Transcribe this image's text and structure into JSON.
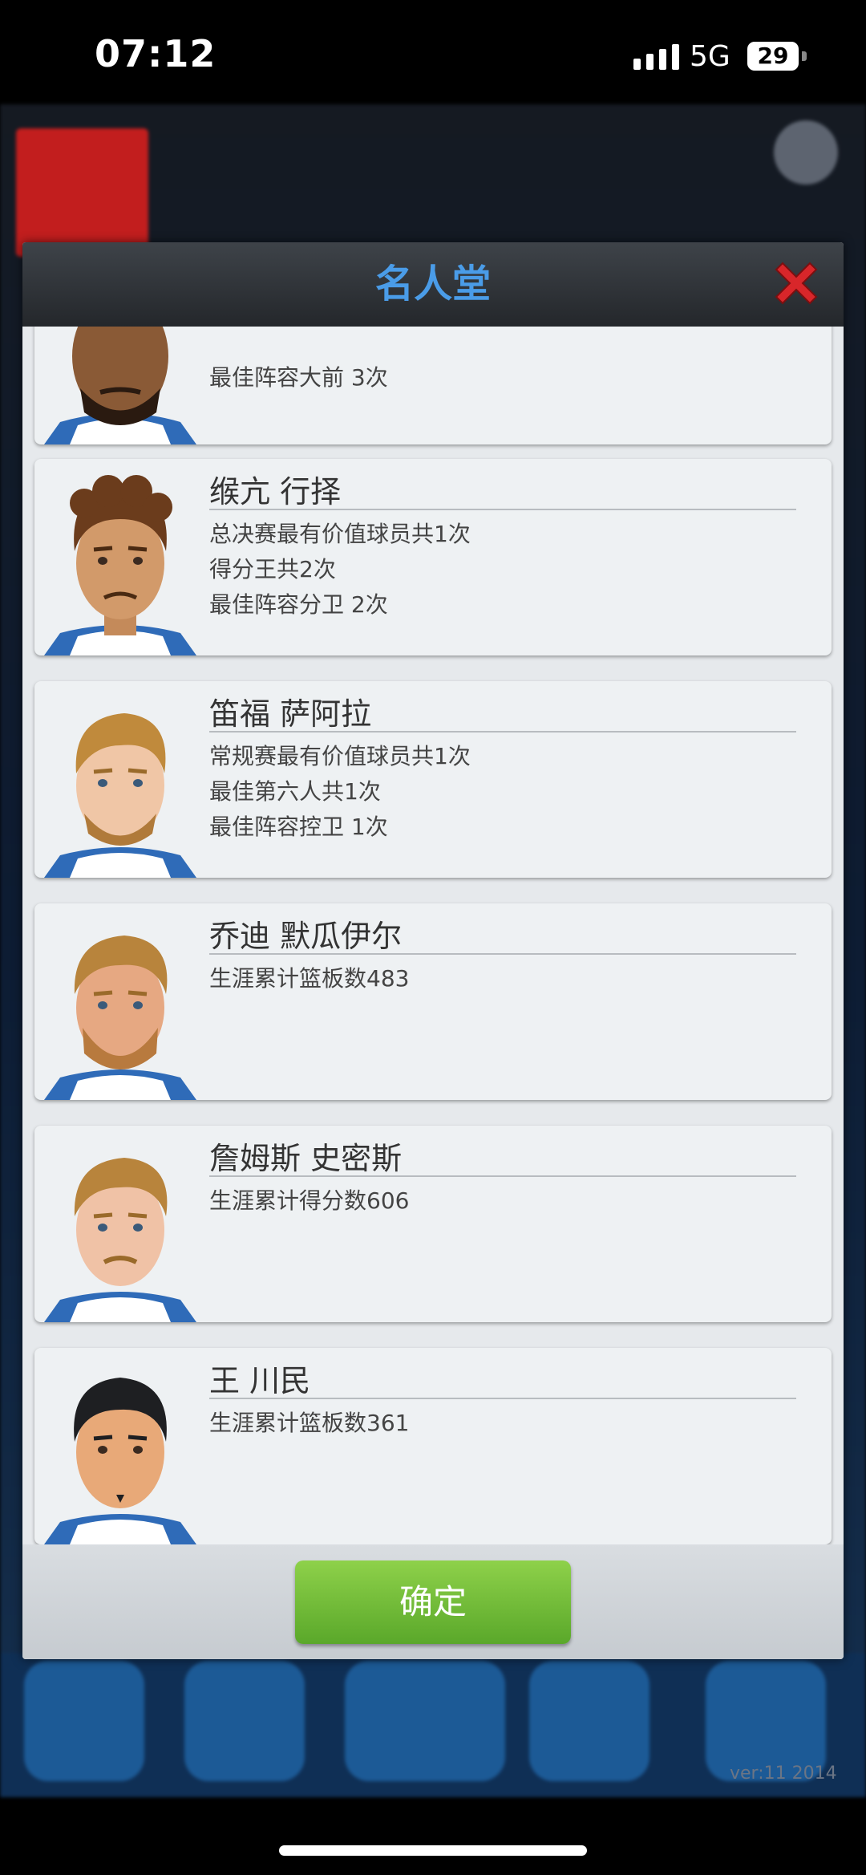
{
  "status_bar": {
    "time": "07:12",
    "network": "5G",
    "battery": "29"
  },
  "dialog": {
    "title": "名人堂",
    "confirm_label": "确定",
    "players": [
      {
        "name": "",
        "stats": [
          "最佳阵容大前  3次"
        ]
      },
      {
        "name": "缑亢 行择",
        "stats": [
          "总决赛最有价值球员共1次",
          "得分王共2次",
          "最佳阵容分卫  2次"
        ]
      },
      {
        "name": "笛福 萨阿拉",
        "stats": [
          "常规赛最有价值球员共1次",
          "最佳第六人共1次",
          "最佳阵容控卫  1次"
        ]
      },
      {
        "name": "乔迪 默瓜伊尔",
        "stats": [
          "生涯累计篮板数483"
        ]
      },
      {
        "name": "詹姆斯 史密斯",
        "stats": [
          "生涯累计得分数606"
        ]
      },
      {
        "name": "王 川民",
        "stats": [
          "生涯累计篮板数361"
        ]
      }
    ]
  },
  "background": {
    "version": "ver:11  2014"
  },
  "colors": {
    "title_blue": "#4a9ce8",
    "confirm_green": "#6fbb34",
    "close_red": "#d8262a"
  }
}
